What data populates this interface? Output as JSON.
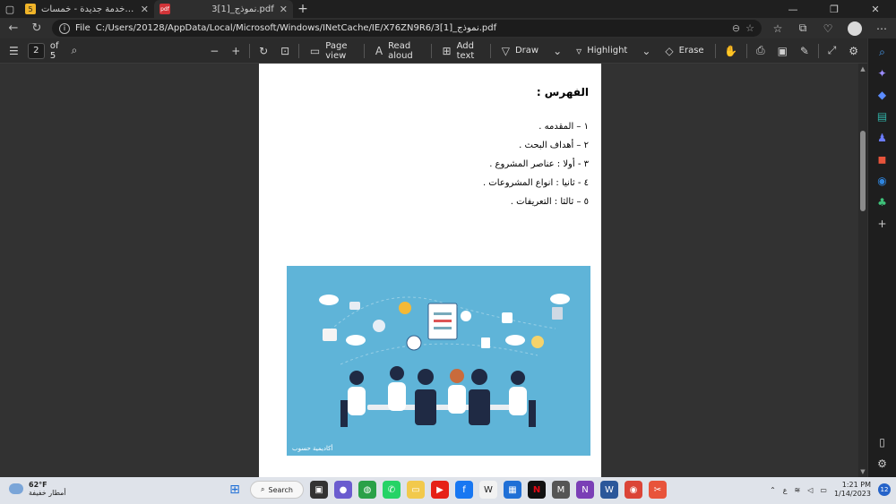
{
  "tabs": [
    {
      "title": "أضف خدمة جديدة - خمسات",
      "favicon_color": "#f0b429",
      "favicon_glyph": "5"
    },
    {
      "title": "نموذج_[1]3.pdf",
      "favicon_color": "#d13438",
      "favicon_glyph": "pdf"
    }
  ],
  "address": {
    "scheme_label": "File",
    "url": "C:/Users/20128/AppData/Local/Microsoft/Windows/INetCache/IE/X76ZN9R6/نموذج_[1]3.pdf"
  },
  "pdf_toolbar": {
    "page_current": "2",
    "page_total": "of 5",
    "page_view": "Page view",
    "read_aloud": "Read aloud",
    "add_text": "Add text",
    "draw": "Draw",
    "highlight": "Highlight",
    "erase": "Erase"
  },
  "document": {
    "title": "الفهرس :",
    "toc": [
      "١ – المقدمه .",
      "٢ – أهداف البحث .",
      "٣ - أولا : عناصر المشروع .",
      "٤ - ثانيا : انواع المشروعات .",
      "٥ – ثالثا : التعريفات ."
    ],
    "logo_text": "أكاديمية حسوب"
  },
  "taskbar": {
    "weather_temp": "62°F",
    "weather_desc": "أمطار خفيفة",
    "search_label": "Search",
    "lang": "ع",
    "time": "1:21 PM",
    "date": "1/14/2023",
    "notifications": "12"
  },
  "colors": {
    "accent": "#2563c9",
    "illustration_bg": "#5fb4d8"
  }
}
